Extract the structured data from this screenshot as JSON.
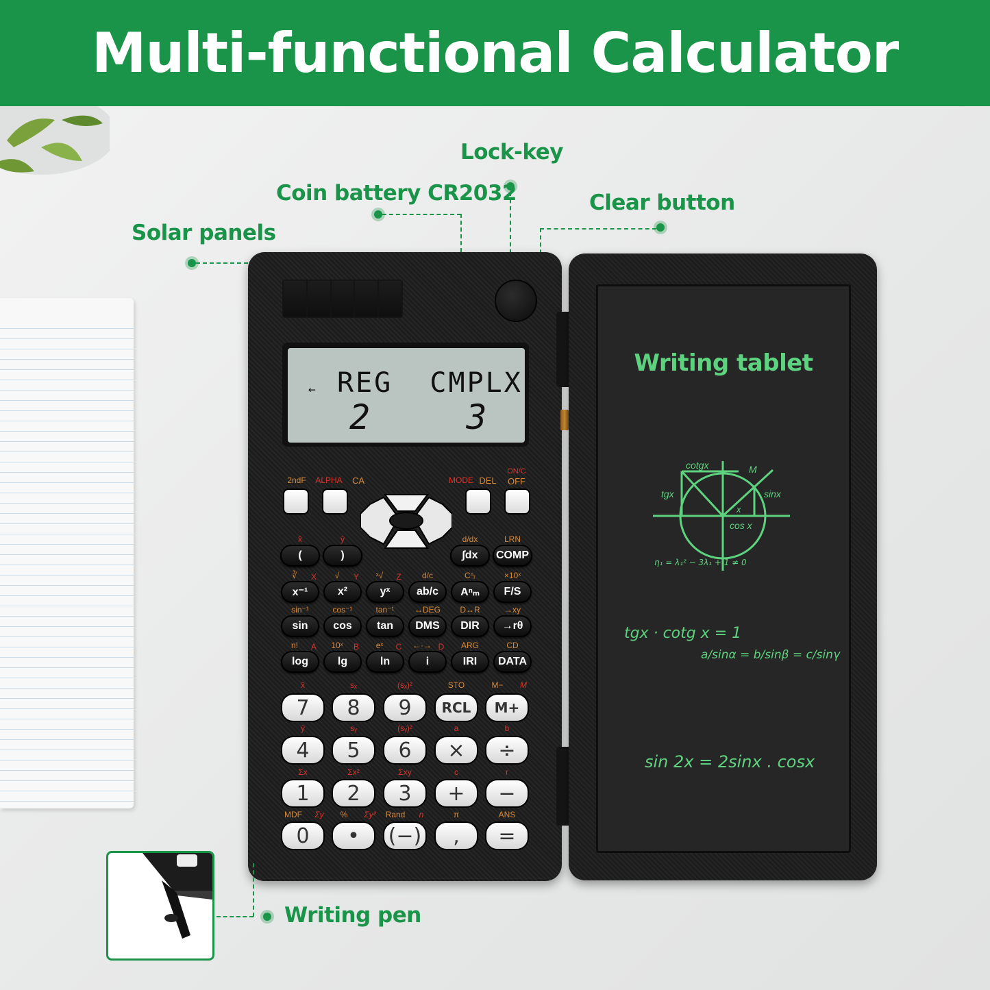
{
  "banner": {
    "title": "Multi-functional Calculator"
  },
  "colors": {
    "brand_green": "#1a9448",
    "tablet_ink": "#5ed37f",
    "key_orange": "#d88a3a",
    "key_red": "#d9342b",
    "lcd": "#bac5c1"
  },
  "callouts": {
    "solar_panels": "Solar panels",
    "coin_battery": "Coin battery CR2032",
    "lock_key": "Lock-key",
    "clear_button": "Clear button",
    "writing_pen": "Writing pen"
  },
  "display": {
    "indicator": "←",
    "top_line": "REG  CMPLX",
    "bottom_left": "2",
    "bottom_right": "3"
  },
  "calculator": {
    "top_keys": [
      {
        "label": "2ndF",
        "color": "orange"
      },
      {
        "label": "ALPHA",
        "color": "red"
      },
      {
        "label": "CA",
        "color": "orange"
      },
      {
        "label": "MODE",
        "color": "red"
      },
      {
        "label": "DEL",
        "color": "orange"
      },
      {
        "label": "ON/C",
        "color": "red"
      },
      {
        "label": "OFF",
        "color": "orange"
      }
    ],
    "row1": [
      {
        "key": "(",
        "sub": "x̂",
        "sub_color": "red"
      },
      {
        "key": ")",
        "sub": "ŷ",
        "sub_color": "red"
      },
      {
        "key": "∫dx",
        "sub": "d/dx",
        "sub_color": "orange"
      },
      {
        "key": "COMP",
        "sub": "LRN",
        "sub_color": "orange"
      }
    ],
    "row2": [
      {
        "key": "x⁻¹",
        "sub": "∛",
        "alpha": "X"
      },
      {
        "key": "x²",
        "sub": "√",
        "alpha": "Y"
      },
      {
        "key": "yˣ",
        "sub": "ˣ√",
        "alpha": "Z"
      },
      {
        "key": "ab/c",
        "sub": "d/c",
        "alpha": ""
      },
      {
        "key": "Aⁿₘ",
        "sub": "Cⁿᵣ",
        "alpha": ""
      },
      {
        "key": "F/S",
        "sub": "×10ˣ",
        "alpha": ""
      }
    ],
    "row3": [
      {
        "key": "sin",
        "sub": "sin⁻¹"
      },
      {
        "key": "cos",
        "sub": "cos⁻¹"
      },
      {
        "key": "tan",
        "sub": "tan⁻¹"
      },
      {
        "key": "DMS",
        "sub": "↔DEG"
      },
      {
        "key": "DIR",
        "sub": "D↔R"
      },
      {
        "key": "→rθ",
        "sub": "→xy"
      }
    ],
    "row4": [
      {
        "key": "log",
        "sub": "n!",
        "alpha": "A"
      },
      {
        "key": "lg",
        "sub": "10ˣ",
        "alpha": "B"
      },
      {
        "key": "ln",
        "sub": "eˣ",
        "alpha": "C"
      },
      {
        "key": "i",
        "sub": "←·→",
        "alpha": "D"
      },
      {
        "key": "IRI",
        "sub": "ARG",
        "alpha": ""
      },
      {
        "key": "DATA",
        "sub": "CD",
        "alpha": ""
      }
    ],
    "row5": [
      {
        "key": "7",
        "sub": "x̄",
        "sub_color": "red"
      },
      {
        "key": "8",
        "sub": "sₓ",
        "sub_color": "red"
      },
      {
        "key": "9",
        "sub": "(sₓ)²",
        "sub_color": "red"
      },
      {
        "key": "RCL",
        "sub": "STO",
        "sub_color": "orange"
      },
      {
        "key": "M+",
        "sub": "M−",
        "sub_color": "orange",
        "alpha": "M"
      }
    ],
    "row6": [
      {
        "key": "4",
        "sub": "ȳ",
        "sub_color": "red"
      },
      {
        "key": "5",
        "sub": "sᵧ",
        "sub_color": "red"
      },
      {
        "key": "6",
        "sub": "(sᵧ)²",
        "sub_color": "red"
      },
      {
        "key": "×",
        "sub": "a",
        "sub_color": "red"
      },
      {
        "key": "÷",
        "sub": "b",
        "sub_color": "red"
      }
    ],
    "row7": [
      {
        "key": "1",
        "sub": "Σx",
        "sub_color": "red"
      },
      {
        "key": "2",
        "sub": "Σx²",
        "sub_color": "red"
      },
      {
        "key": "3",
        "sub": "Σxy",
        "sub_color": "red"
      },
      {
        "key": "+",
        "sub": "c",
        "sub_color": "red"
      },
      {
        "key": "−",
        "sub": "r",
        "sub_color": "red"
      }
    ],
    "row8": [
      {
        "key": "0",
        "sub": "MDF",
        "sub_color": "orange",
        "alpha": "Σy"
      },
      {
        "key": "•",
        "sub": "%",
        "sub_color": "orange",
        "alpha": "Σy²"
      },
      {
        "key": "(−)",
        "sub": "Rand",
        "sub_color": "orange",
        "alpha": "n"
      },
      {
        "key": ",",
        "sub": "π",
        "sub_color": "orange"
      },
      {
        "key": "=",
        "sub": "ANS",
        "sub_color": "orange"
      }
    ]
  },
  "tablet": {
    "title": "Writing tablet",
    "diagram_labels": {
      "cotg": "cotgx",
      "tg": "tgx",
      "M": "M",
      "sin": "sinx",
      "x": "x",
      "cos": "cos x",
      "equation": "η₁ = λ₁² − 3λ₁ + 1 ≠ 0"
    },
    "formula1": "tgx · cotg x = 1",
    "formula2": "a/sinα = b/sinβ = c/sinγ",
    "formula3": "sin 2x = 2sinx . cosx"
  }
}
